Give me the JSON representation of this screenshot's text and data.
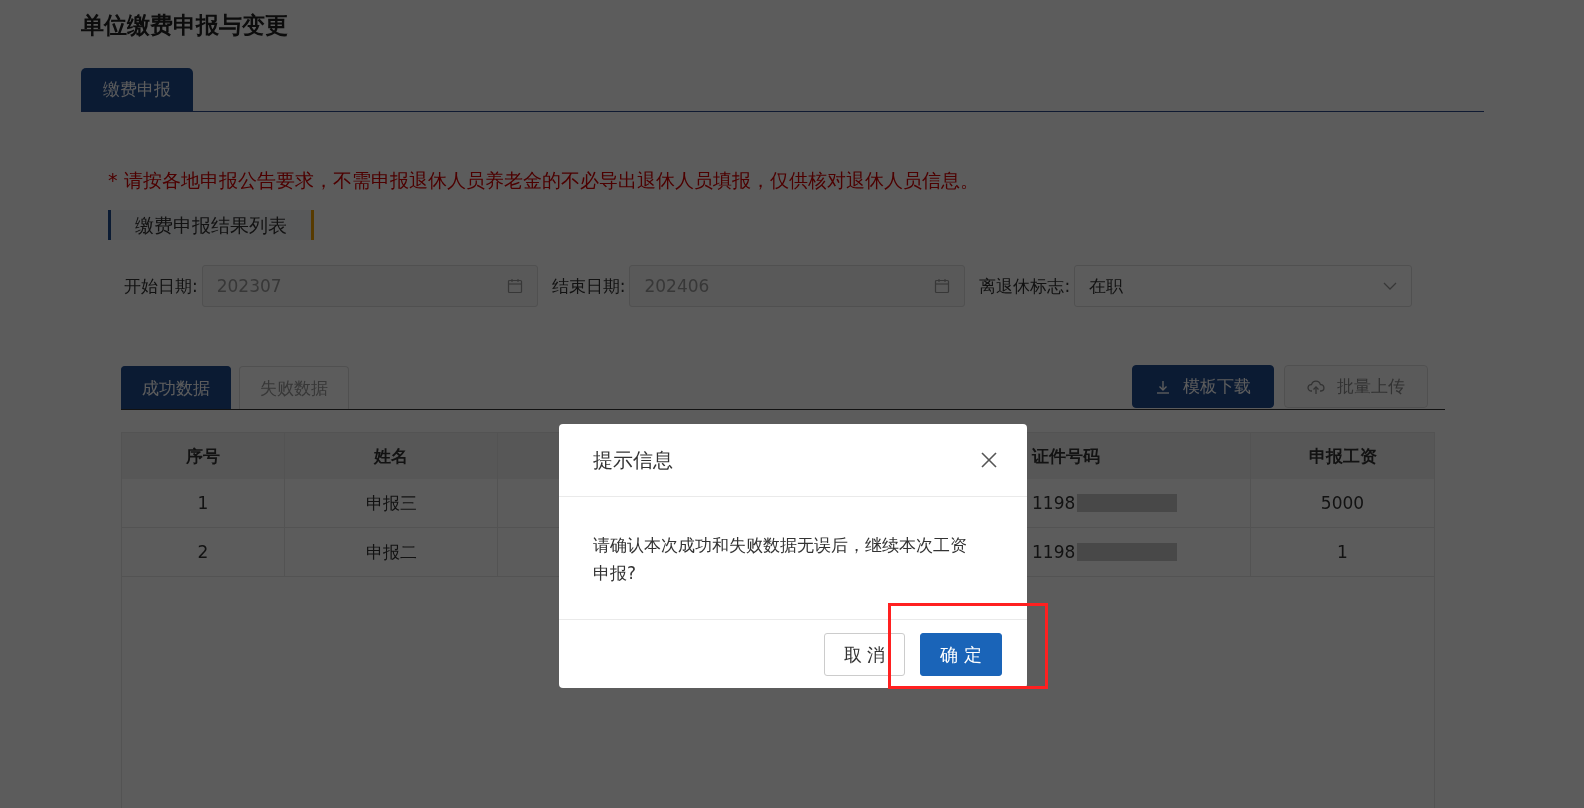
{
  "page_title": "单位缴费申报与变更",
  "tabs": [
    {
      "label": "缴费申报",
      "selected": true
    }
  ],
  "notice": "* 请按各地申报公告要求，不需申报退休人员养老金的不必导出退休人员填报，仅供核对退休人员信息。",
  "section_title": "缴费申报结果列表",
  "filters": [
    {
      "kind": "date",
      "label": "开始日期:",
      "value": "202307"
    },
    {
      "kind": "date",
      "label": "结束日期:",
      "value": "202406"
    },
    {
      "kind": "select",
      "label": "离退休标志:",
      "value": "在职"
    }
  ],
  "data_tabs": [
    {
      "label": "成功数据",
      "selected": true
    },
    {
      "label": "失败数据",
      "selected": false
    }
  ],
  "actions": [
    {
      "kind": "download",
      "label": "模板下载",
      "disabled": false
    },
    {
      "kind": "upload",
      "label": "批量上传",
      "disabled": true
    }
  ],
  "table": {
    "columns": [
      {
        "kind": "text",
        "label": "序号"
      },
      {
        "kind": "text",
        "label": "姓名"
      },
      {
        "kind": "blank"
      },
      {
        "kind": "partial",
        "label": "证件号码"
      },
      {
        "kind": "text",
        "label": "申报工资"
      }
    ],
    "rows": [
      {
        "index": "1",
        "name": "申报三",
        "id_number": "1198",
        "salary": "5000"
      },
      {
        "index": "2",
        "name": "申报二",
        "id_number": "1198",
        "salary": "1"
      }
    ]
  },
  "dialog": {
    "title": "提示信息",
    "message": "请确认本次成功和失败数据无误后，继续本次工资申报?",
    "buttons": [
      {
        "kind": "secondary",
        "label": "取 消"
      },
      {
        "kind": "primary",
        "label": "确 定"
      }
    ],
    "highlight_confirm": true
  }
}
